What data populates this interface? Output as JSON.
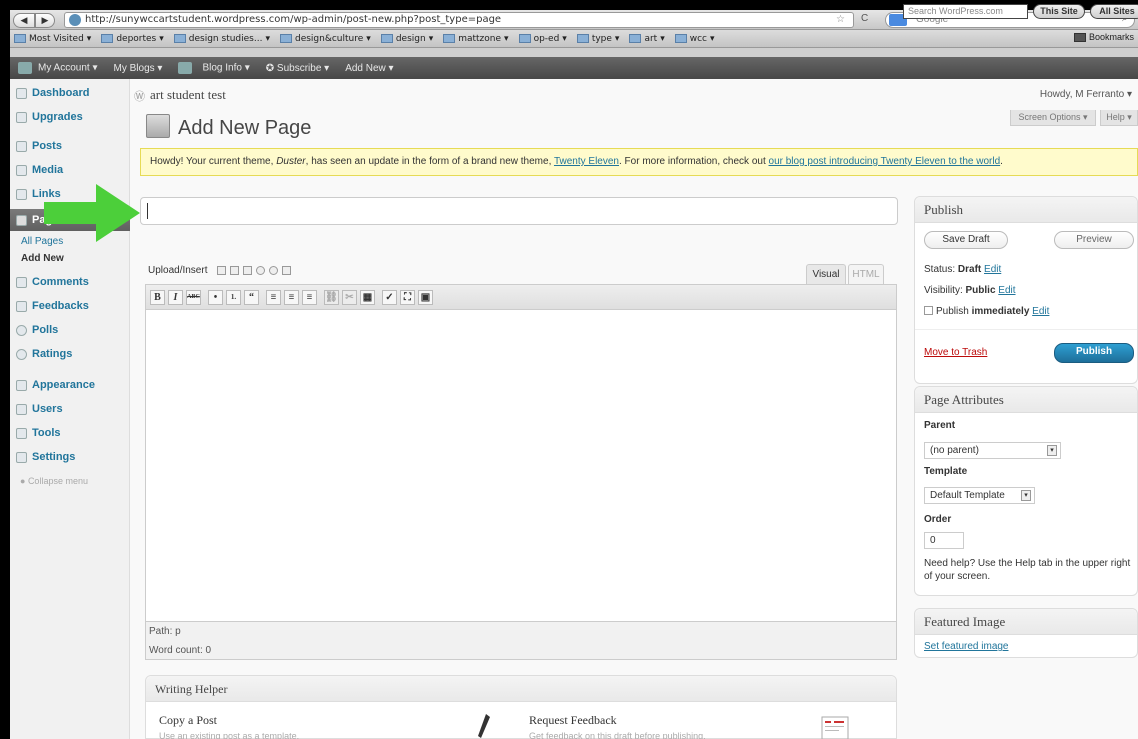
{
  "browser": {
    "url": "http://sunywccartstudent.wordpress.com/wp-admin/post-new.php?post_type=page",
    "search_placeholder": "Google",
    "bookmarks": [
      "Most Visited",
      "deportes",
      "design studies...",
      "design&culture",
      "design",
      "mattzone",
      "op-ed",
      "type",
      "art",
      "wcc"
    ],
    "bookmarks_right": "Bookmarks"
  },
  "adminbar": {
    "items": [
      "My Account",
      "My Blogs",
      "Blog Info",
      "Subscribe",
      "Add New"
    ],
    "search_placeholder": "Search WordPress.com",
    "this_site": "This Site",
    "all_sites": "All Sites"
  },
  "sidebar": {
    "items": [
      "Dashboard",
      "Upgrades",
      "Posts",
      "Media",
      "Links",
      "Pages",
      "Comments",
      "Feedbacks",
      "Polls",
      "Ratings",
      "Appearance",
      "Users",
      "Tools",
      "Settings"
    ],
    "active_label": "Pag",
    "sub_items": [
      "All Pages",
      "Add New"
    ],
    "collapse": "Collapse menu"
  },
  "header": {
    "site_title": "art student test",
    "howdy": "Howdy, M Ferranto",
    "page_title": "Add New Page",
    "screen_options": "Screen Options",
    "help": "Help"
  },
  "notice": {
    "text_a": "Howdy! Your current theme, ",
    "theme": "Duster",
    "text_b": ", has seen an update in the form of a brand new theme, ",
    "new_theme": "Twenty Eleven",
    "text_c": ". For more information, check out ",
    "link": "our blog post introducing Twenty Eleven to the world",
    "text_d": "."
  },
  "editor": {
    "upload_label": "Upload/Insert",
    "visual_tab": "Visual",
    "html_tab": "HTML",
    "path": "Path: p",
    "word_count": "Word count: 0",
    "toolbar_buttons": [
      "B",
      "I",
      "ABC",
      "•",
      "1.",
      "“",
      "≡",
      "≡",
      "≡",
      "⛓",
      "✂",
      "▦",
      "✓",
      "⛶",
      "▣"
    ]
  },
  "publish": {
    "title": "Publish",
    "save_draft": "Save Draft",
    "preview": "Preview",
    "status_label": "Status: ",
    "status_value": "Draft",
    "visibility_label": "Visibility: ",
    "visibility_value": "Public",
    "schedule_label": "Publish ",
    "schedule_value": "immediately",
    "edit": "Edit",
    "trash": "Move to Trash",
    "publish_btn": "Publish"
  },
  "attributes": {
    "title": "Page Attributes",
    "parent_label": "Parent",
    "parent_value": "(no parent)",
    "template_label": "Template",
    "template_value": "Default Template",
    "order_label": "Order",
    "order_value": "0",
    "help_text": "Need help? Use the Help tab in the upper right of your screen."
  },
  "featured": {
    "title": "Featured Image",
    "link": "Set featured image"
  },
  "helper": {
    "title": "Writing Helper",
    "copy_title": "Copy a Post",
    "copy_desc": "Use an existing post as a template.",
    "feedback_title": "Request Feedback",
    "feedback_desc": "Get feedback on this draft before publishing."
  },
  "colors": {
    "accent_link": "#21759b",
    "arrow": "#4ccf3a",
    "publish": "#2184b5",
    "notice_bg": "#fffbcc"
  }
}
